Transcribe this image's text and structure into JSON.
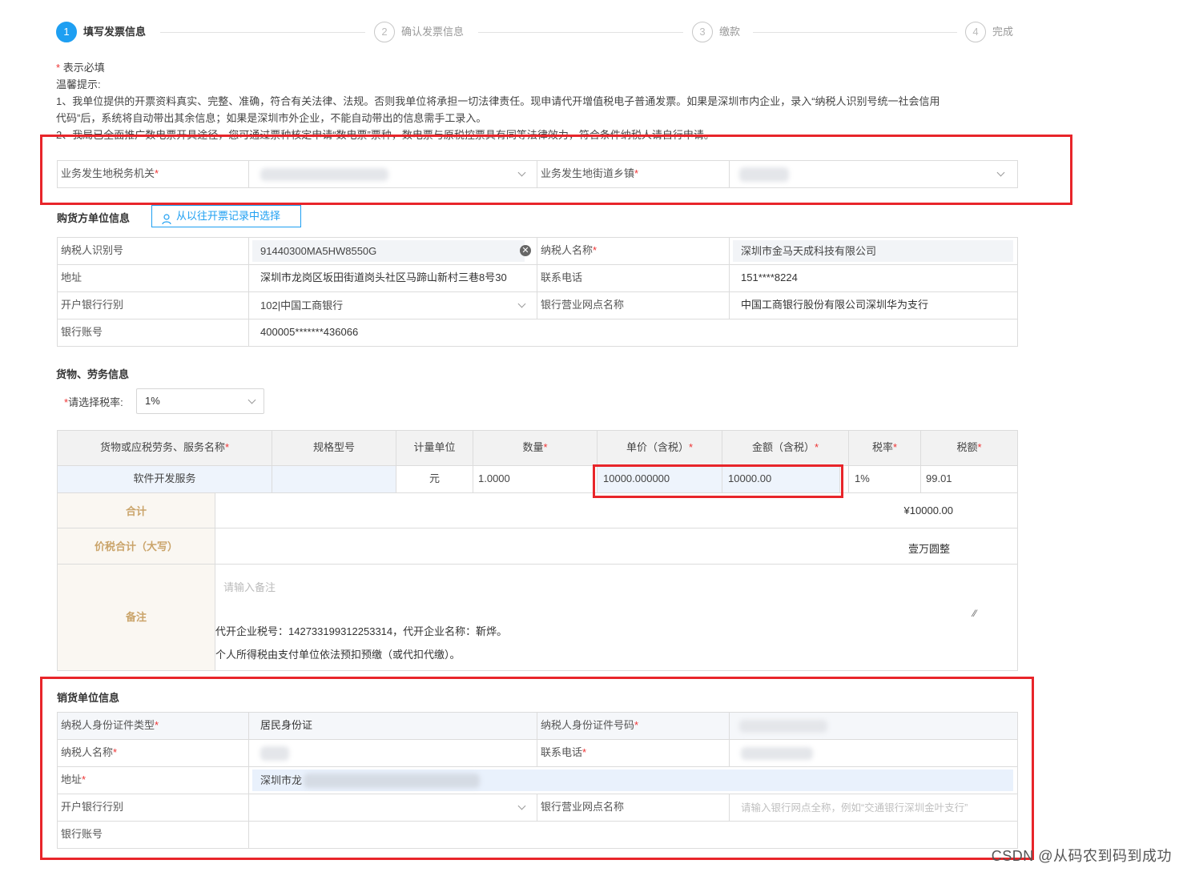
{
  "steps": [
    {
      "num": "1",
      "label": "填写发票信息"
    },
    {
      "num": "2",
      "label": "确认发票信息"
    },
    {
      "num": "3",
      "label": "缴款"
    },
    {
      "num": "4",
      "label": "完成"
    }
  ],
  "tips": {
    "required_mark": "*",
    "required_note": "表示必填",
    "title": "温馨提示:",
    "line1": "1、我单位提供的开票资料真实、完整、准确，符合有关法律、法规。否则我单位将承担一切法律责任。现申请代开增值税电子普通发票。如果是深圳市内企业，录入“纳税人识别号统一社会信用",
    "line2": "代码”后，系统将自动带出其余信息；如果是深圳市外企业，不能自动带出的信息需手工录入。",
    "line3": "2、我局已全面推广数电票开具途径，您可通过票种核定申请“数电票”票种，数电票与原税控票具有同等法律效力，符合条件纳税人请自行申请。"
  },
  "location": {
    "tax_office_label": "业务发生地税务机关",
    "street_label": "业务发生地街道乡镇"
  },
  "buyer": {
    "section_title": "购货方单位信息",
    "history_button": "从以往开票记录中选择",
    "taxpayer_id_label": "纳税人识别号",
    "taxpayer_id_value": "91440300MA5HW8550G",
    "taxpayer_name_label": "纳税人名称",
    "taxpayer_name_value": "深圳市金马天成科技有限公司",
    "address_label": "地址",
    "address_value": "深圳市龙岗区坂田街道岗头社区马蹄山新村三巷8号30",
    "phone_label": "联系电话",
    "phone_value": "151****8224",
    "bank_label": "开户银行行别",
    "bank_value": "102|中国工商银行",
    "branch_label": "银行营业网点名称",
    "branch_value": "中国工商银行股份有限公司深圳华为支行",
    "account_label": "银行账号",
    "account_value": "400005*******436066"
  },
  "goods": {
    "section_title": "货物、劳务信息",
    "tax_rate_label": "请选择税率:",
    "tax_rate_value": "1%",
    "headers": [
      "货物或应税劳务、服务名称",
      "规格型号",
      "计量单位",
      "数量",
      "单价（含税）",
      "金额（含税）",
      "税率",
      "税额"
    ],
    "row": {
      "name": "软件开发服务",
      "spec": "",
      "unit": "元",
      "quantity": "1.0000",
      "unit_price": "10000.000000",
      "amount": "10000.00",
      "tax_rate": "1%",
      "tax": "99.01"
    },
    "total_label": "合计",
    "total_value": "¥10000.00",
    "total_caps_label": "价税合计（大写）",
    "total_caps_value": "壹万圆整",
    "remark_label": "备注",
    "remark_placeholder": "请输入备注",
    "remark_line1": "代开企业税号：142733199312253314，代开企业名称：靳烨。",
    "remark_line2": "个人所得税由支付单位依法预扣预缴（或代扣代缴）。"
  },
  "seller": {
    "section_title": "销货单位信息",
    "id_type_label": "纳税人身份证件类型",
    "id_type_value": "居民身份证",
    "id_number_label": "纳税人身份证件号码",
    "name_label": "纳税人名称",
    "phone_label": "联系电话",
    "address_label": "地址",
    "address_value": "深圳市龙",
    "bank_label": "开户银行行别",
    "branch_label": "银行营业网点名称",
    "branch_placeholder": "请输入银行网点全称，例如“交通银行深圳金叶支行”",
    "account_label": "银行账号"
  },
  "watermark": "CSDN @从码农到码到成功"
}
